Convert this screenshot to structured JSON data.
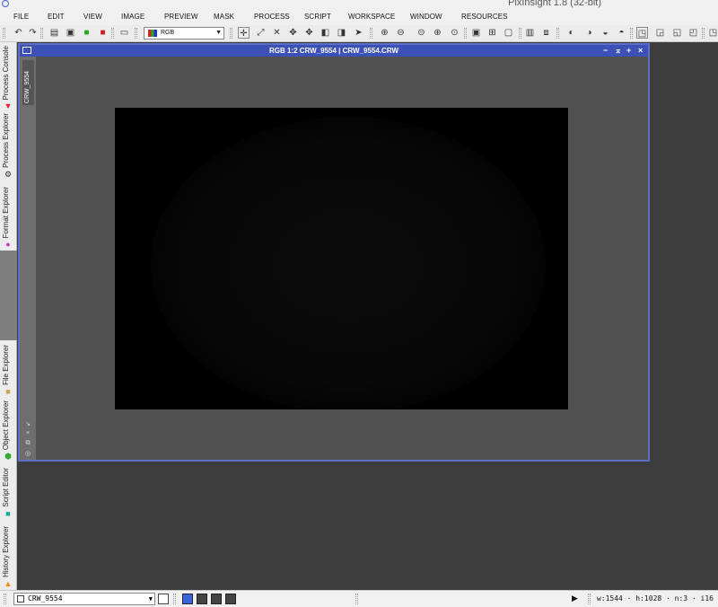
{
  "window": {
    "title": "PixInsight 1.8 (32-bit)"
  },
  "menu": [
    "FILE",
    "EDIT",
    "VIEW",
    "IMAGE",
    "PREVIEW",
    "MASK",
    "PROCESS",
    "SCRIPT",
    "WORKSPACE",
    "WINDOW",
    "RESOURCES"
  ],
  "toolbar": {
    "channel_select": "RGB"
  },
  "side_tabs": [
    "Process Console",
    "Process Explorer",
    "Format Explorer",
    "File Explorer",
    "Object Explorer",
    "Script Editor",
    "History Explorer"
  ],
  "image_window": {
    "title": "RGB 1:2 CRW_9554 | CRW_9554.CRW",
    "view_tab": "CRW_9554"
  },
  "status": {
    "view_select": "CRW_9554",
    "readout": "w:1544 · h:1028 · n:3 · i16"
  },
  "colors": {
    "window_title_bg": "#3c51b8",
    "workspace_bg": "#3c3c3c",
    "accent": "#5d6fc4"
  }
}
